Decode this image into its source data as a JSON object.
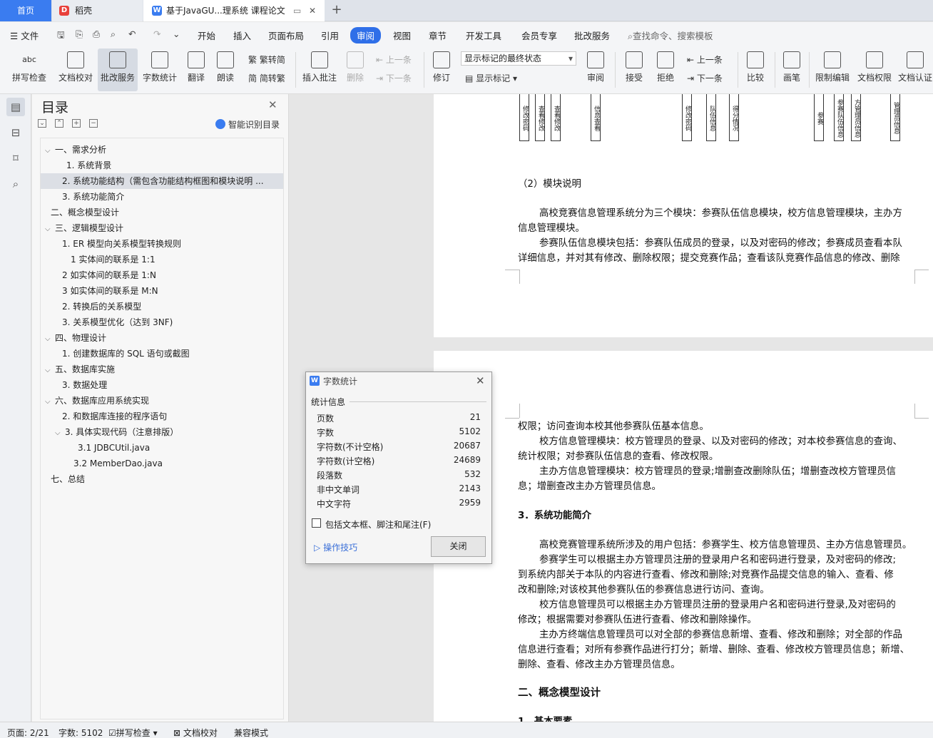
{
  "tabs": {
    "home": "首页",
    "docer": "稻壳",
    "doc": "基于JavaGU...理系统 课程论文",
    "new_tab": "+"
  },
  "menu": {
    "file": "文件",
    "items": [
      "开始",
      "插入",
      "页面布局",
      "引用",
      "审阅",
      "视图",
      "章节",
      "开发工具",
      "会员专享",
      "批改服务"
    ],
    "active": "审阅",
    "search": "查找命令、搜索模板"
  },
  "ribbon": {
    "spell": "拼写检查",
    "proof": "文档校对",
    "review_service": "批改服务",
    "wordcount": "字数统计",
    "translate": "翻译",
    "read": "朗读",
    "trad": "繁转简",
    "simp": "简转繁",
    "insert_comment": "插入批注",
    "delete": "删除",
    "prev": "上一条",
    "next": "下一条",
    "track": "修订",
    "markup_state": "显示标记的最终状态",
    "show_markup": "显示标记",
    "review": "审阅",
    "accept": "接受",
    "reject": "拒绝",
    "prev2": "上一条",
    "next2": "下一条",
    "compare": "比较",
    "pen": "画笔",
    "restrict": "限制编辑",
    "doc_perm": "文档权限",
    "doc_cert": "文档认证"
  },
  "toc": {
    "title": "目录",
    "smart": "智能识别目录",
    "items": [
      {
        "text": "一、需求分析",
        "arrow": "⌵"
      },
      {
        "text": "1. 系统背景",
        "arrow": ""
      },
      {
        "text": "2. 系统功能结构（需包含功能结构框图和模块说明 ...",
        "arrow": ""
      },
      {
        "text": "3. 系统功能简介",
        "arrow": ""
      },
      {
        "text": "二、概念模型设计",
        "arrow": ""
      },
      {
        "text": "三、逻辑模型设计",
        "arrow": "⌵"
      },
      {
        "text": "1. ER 模型向关系模型转换规则",
        "arrow": ""
      },
      {
        "text": "1 实体间的联系是 1:1",
        "arrow": ""
      },
      {
        "text": "2 如实体间的联系是 1:N",
        "arrow": ""
      },
      {
        "text": "3 如实体间的联系是 M:N",
        "arrow": ""
      },
      {
        "text": "2. 转换后的关系模型",
        "arrow": ""
      },
      {
        "text": "3. 关系模型优化（达到 3NF)",
        "arrow": ""
      },
      {
        "text": "四、物理设计",
        "arrow": "⌵"
      },
      {
        "text": "1. 创建数据库的 SQL 语句或截图",
        "arrow": ""
      },
      {
        "text": "五、数据库实施",
        "arrow": "⌵"
      },
      {
        "text": "3. 数据处理",
        "arrow": ""
      },
      {
        "text": "六、数据库应用系统实现",
        "arrow": "⌵"
      },
      {
        "text": "2. 和数据库连接的程序语句",
        "arrow": ""
      },
      {
        "text": "3. 具体实现代码（注意排版）",
        "arrow": "⌵"
      },
      {
        "text": "3.1 JDBCUtil.java",
        "arrow": ""
      },
      {
        "text": "3.2 MemberDao.java",
        "arrow": ""
      },
      {
        "text": "七、总结",
        "arrow": ""
      }
    ]
  },
  "doc": {
    "diagram_boxes": [
      "修改密码",
      "查看修改",
      "查看修改",
      "信息查看",
      "修改密码",
      "队伍信息",
      "得分情况",
      "参赛",
      "参赛队伍信息",
      "方管理员信息",
      "管理员信息"
    ],
    "page1": [
      "（2）模块说明",
      "高校竞赛信息管理系统分为三个模块：参赛队伍信息模块，校方信息管理模块，主办方",
      "信息管理模块。",
      "参赛队伍信息模块包括：参赛队伍成员的登录，以及对密码的修改；参赛成员查看本队",
      "详细信息，并对其有修改、删除权限；提交竞赛作品；查看该队竞赛作品信息的修改、删除"
    ],
    "page2": [
      "权限；访问查询本校其他参赛队伍基本信息。",
      "校方信息管理模块：校方管理员的登录、以及对密码的修改；对本校参赛信息的查询、",
      "统计权限；对参赛队伍信息的查看、修改权限。",
      "主办方信息管理模块：校方管理员的登录;增删查改删除队伍；增删查改校方管理员信",
      "息；增删查改主办方管理员信息。",
      "3．系统功能简介",
      "高校竞赛管理系统所涉及的用户包括：参赛学生、校方信息管理员、主办方信息管理员。",
      "参赛学生可以根据主办方管理员注册的登录用户名和密码进行登录，及对密码的修改;",
      "到系统内部关于本队的内容进行查看、修改和删除;对竞赛作品提交信息的输入、查看、修",
      "改和删除;对该校其他参赛队伍的参赛信息进行访问、查询。",
      "校方信息管理员可以根据主办方管理员注册的登录用户名和密码进行登录,及对密码的",
      "修改；根据需要对参赛队伍进行查看、修改和删除操作。",
      "主办方终端信息管理员可以对全部的参赛信息新增、查看、修改和删除；对全部的作品",
      "信息进行查看；对所有参赛作品进行打分；新增、删除、查看、修改校方管理员信息；新增、",
      "删除、查看、修改主办方管理员信息。",
      "二、概念模型设计",
      "1．基本要素"
    ]
  },
  "dialog": {
    "title": "字数统计",
    "section": "统计信息",
    "rows": [
      {
        "label": "页数",
        "value": "21"
      },
      {
        "label": "字数",
        "value": "5102"
      },
      {
        "label": "字符数(不计空格)",
        "value": "20687"
      },
      {
        "label": "字符数(计空格)",
        "value": "24689"
      },
      {
        "label": "段落数",
        "value": "532"
      },
      {
        "label": "非中文单词",
        "value": "2143"
      },
      {
        "label": "中文字符",
        "value": "2959"
      }
    ],
    "include_label": "包括文本框、脚注和尾注(F)",
    "tips": "操作技巧",
    "close": "关闭"
  },
  "status": {
    "page": "页面: 2/21",
    "words": "字数: 5102",
    "spell": "拼写检查",
    "proof": "文档校对",
    "compat": "兼容模式"
  },
  "colors": {
    "accent": "#3a7cf0",
    "docer": "#e8403a"
  }
}
